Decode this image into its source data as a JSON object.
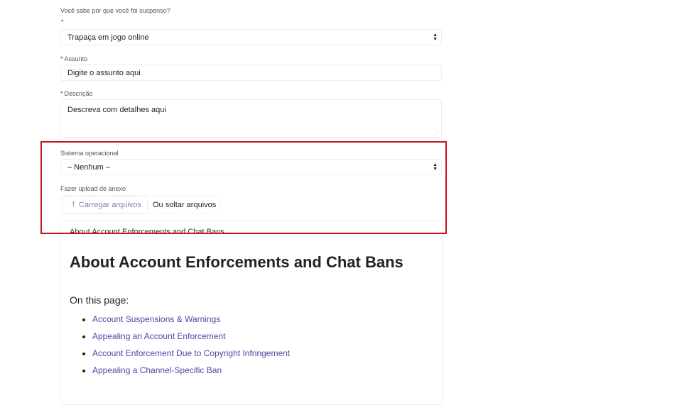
{
  "form": {
    "question_label": "Você sabe por que você foi suspenso?",
    "required_mark": "*",
    "reason_value": "Trapaça em jogo online",
    "subject_label": "Assunto",
    "subject_placeholder": "Digite o assunto aqui",
    "description_label": "Descrição",
    "description_placeholder": "Descreva com detalhes aqui",
    "os_label": "Sistema operacional",
    "os_value": "– Nenhum –",
    "upload_label": "Fazer upload de anexo",
    "upload_button": "Carregar arquivos",
    "drop_text": "Ou soltar arquivos"
  },
  "article": {
    "breadcrumb": "About Account Enforcements and Chat Bans",
    "title": "About Account Enforcements and Chat Bans",
    "toc_label": "On this page:",
    "links": [
      "Account Suspensions & Warnings",
      "Appealing an Account Enforcement",
      "Account Enforcement Due to Copyright Infringement",
      "Appealing a Channel-Specific Ban"
    ]
  },
  "colors": {
    "highlight": "#c4161c",
    "link": "#5a3ea6",
    "required": "#cc0000"
  }
}
